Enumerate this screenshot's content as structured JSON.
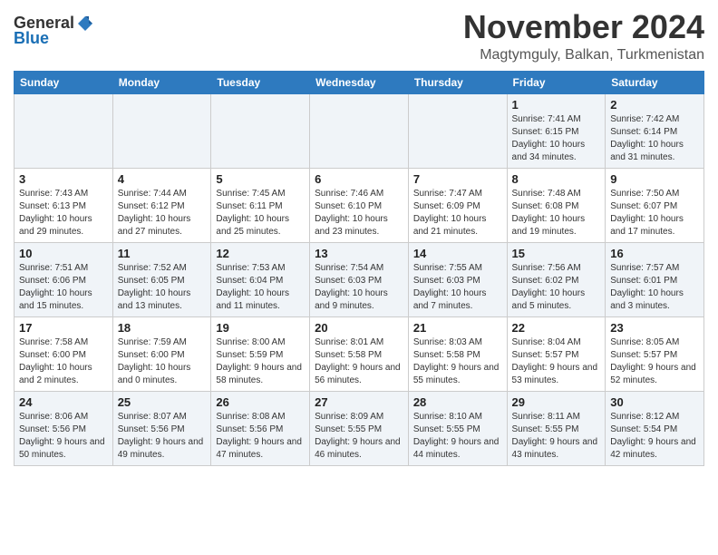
{
  "logo": {
    "general": "General",
    "blue": "Blue"
  },
  "title": "November 2024",
  "subtitle": "Magtymguly, Balkan, Turkmenistan",
  "days_of_week": [
    "Sunday",
    "Monday",
    "Tuesday",
    "Wednesday",
    "Thursday",
    "Friday",
    "Saturday"
  ],
  "weeks": [
    [
      {
        "day": "",
        "info": ""
      },
      {
        "day": "",
        "info": ""
      },
      {
        "day": "",
        "info": ""
      },
      {
        "day": "",
        "info": ""
      },
      {
        "day": "",
        "info": ""
      },
      {
        "day": "1",
        "info": "Sunrise: 7:41 AM\nSunset: 6:15 PM\nDaylight: 10 hours and 34 minutes."
      },
      {
        "day": "2",
        "info": "Sunrise: 7:42 AM\nSunset: 6:14 PM\nDaylight: 10 hours and 31 minutes."
      }
    ],
    [
      {
        "day": "3",
        "info": "Sunrise: 7:43 AM\nSunset: 6:13 PM\nDaylight: 10 hours and 29 minutes."
      },
      {
        "day": "4",
        "info": "Sunrise: 7:44 AM\nSunset: 6:12 PM\nDaylight: 10 hours and 27 minutes."
      },
      {
        "day": "5",
        "info": "Sunrise: 7:45 AM\nSunset: 6:11 PM\nDaylight: 10 hours and 25 minutes."
      },
      {
        "day": "6",
        "info": "Sunrise: 7:46 AM\nSunset: 6:10 PM\nDaylight: 10 hours and 23 minutes."
      },
      {
        "day": "7",
        "info": "Sunrise: 7:47 AM\nSunset: 6:09 PM\nDaylight: 10 hours and 21 minutes."
      },
      {
        "day": "8",
        "info": "Sunrise: 7:48 AM\nSunset: 6:08 PM\nDaylight: 10 hours and 19 minutes."
      },
      {
        "day": "9",
        "info": "Sunrise: 7:50 AM\nSunset: 6:07 PM\nDaylight: 10 hours and 17 minutes."
      }
    ],
    [
      {
        "day": "10",
        "info": "Sunrise: 7:51 AM\nSunset: 6:06 PM\nDaylight: 10 hours and 15 minutes."
      },
      {
        "day": "11",
        "info": "Sunrise: 7:52 AM\nSunset: 6:05 PM\nDaylight: 10 hours and 13 minutes."
      },
      {
        "day": "12",
        "info": "Sunrise: 7:53 AM\nSunset: 6:04 PM\nDaylight: 10 hours and 11 minutes."
      },
      {
        "day": "13",
        "info": "Sunrise: 7:54 AM\nSunset: 6:03 PM\nDaylight: 10 hours and 9 minutes."
      },
      {
        "day": "14",
        "info": "Sunrise: 7:55 AM\nSunset: 6:03 PM\nDaylight: 10 hours and 7 minutes."
      },
      {
        "day": "15",
        "info": "Sunrise: 7:56 AM\nSunset: 6:02 PM\nDaylight: 10 hours and 5 minutes."
      },
      {
        "day": "16",
        "info": "Sunrise: 7:57 AM\nSunset: 6:01 PM\nDaylight: 10 hours and 3 minutes."
      }
    ],
    [
      {
        "day": "17",
        "info": "Sunrise: 7:58 AM\nSunset: 6:00 PM\nDaylight: 10 hours and 2 minutes."
      },
      {
        "day": "18",
        "info": "Sunrise: 7:59 AM\nSunset: 6:00 PM\nDaylight: 10 hours and 0 minutes."
      },
      {
        "day": "19",
        "info": "Sunrise: 8:00 AM\nSunset: 5:59 PM\nDaylight: 9 hours and 58 minutes."
      },
      {
        "day": "20",
        "info": "Sunrise: 8:01 AM\nSunset: 5:58 PM\nDaylight: 9 hours and 56 minutes."
      },
      {
        "day": "21",
        "info": "Sunrise: 8:03 AM\nSunset: 5:58 PM\nDaylight: 9 hours and 55 minutes."
      },
      {
        "day": "22",
        "info": "Sunrise: 8:04 AM\nSunset: 5:57 PM\nDaylight: 9 hours and 53 minutes."
      },
      {
        "day": "23",
        "info": "Sunrise: 8:05 AM\nSunset: 5:57 PM\nDaylight: 9 hours and 52 minutes."
      }
    ],
    [
      {
        "day": "24",
        "info": "Sunrise: 8:06 AM\nSunset: 5:56 PM\nDaylight: 9 hours and 50 minutes."
      },
      {
        "day": "25",
        "info": "Sunrise: 8:07 AM\nSunset: 5:56 PM\nDaylight: 9 hours and 49 minutes."
      },
      {
        "day": "26",
        "info": "Sunrise: 8:08 AM\nSunset: 5:56 PM\nDaylight: 9 hours and 47 minutes."
      },
      {
        "day": "27",
        "info": "Sunrise: 8:09 AM\nSunset: 5:55 PM\nDaylight: 9 hours and 46 minutes."
      },
      {
        "day": "28",
        "info": "Sunrise: 8:10 AM\nSunset: 5:55 PM\nDaylight: 9 hours and 44 minutes."
      },
      {
        "day": "29",
        "info": "Sunrise: 8:11 AM\nSunset: 5:55 PM\nDaylight: 9 hours and 43 minutes."
      },
      {
        "day": "30",
        "info": "Sunrise: 8:12 AM\nSunset: 5:54 PM\nDaylight: 9 hours and 42 minutes."
      }
    ]
  ]
}
